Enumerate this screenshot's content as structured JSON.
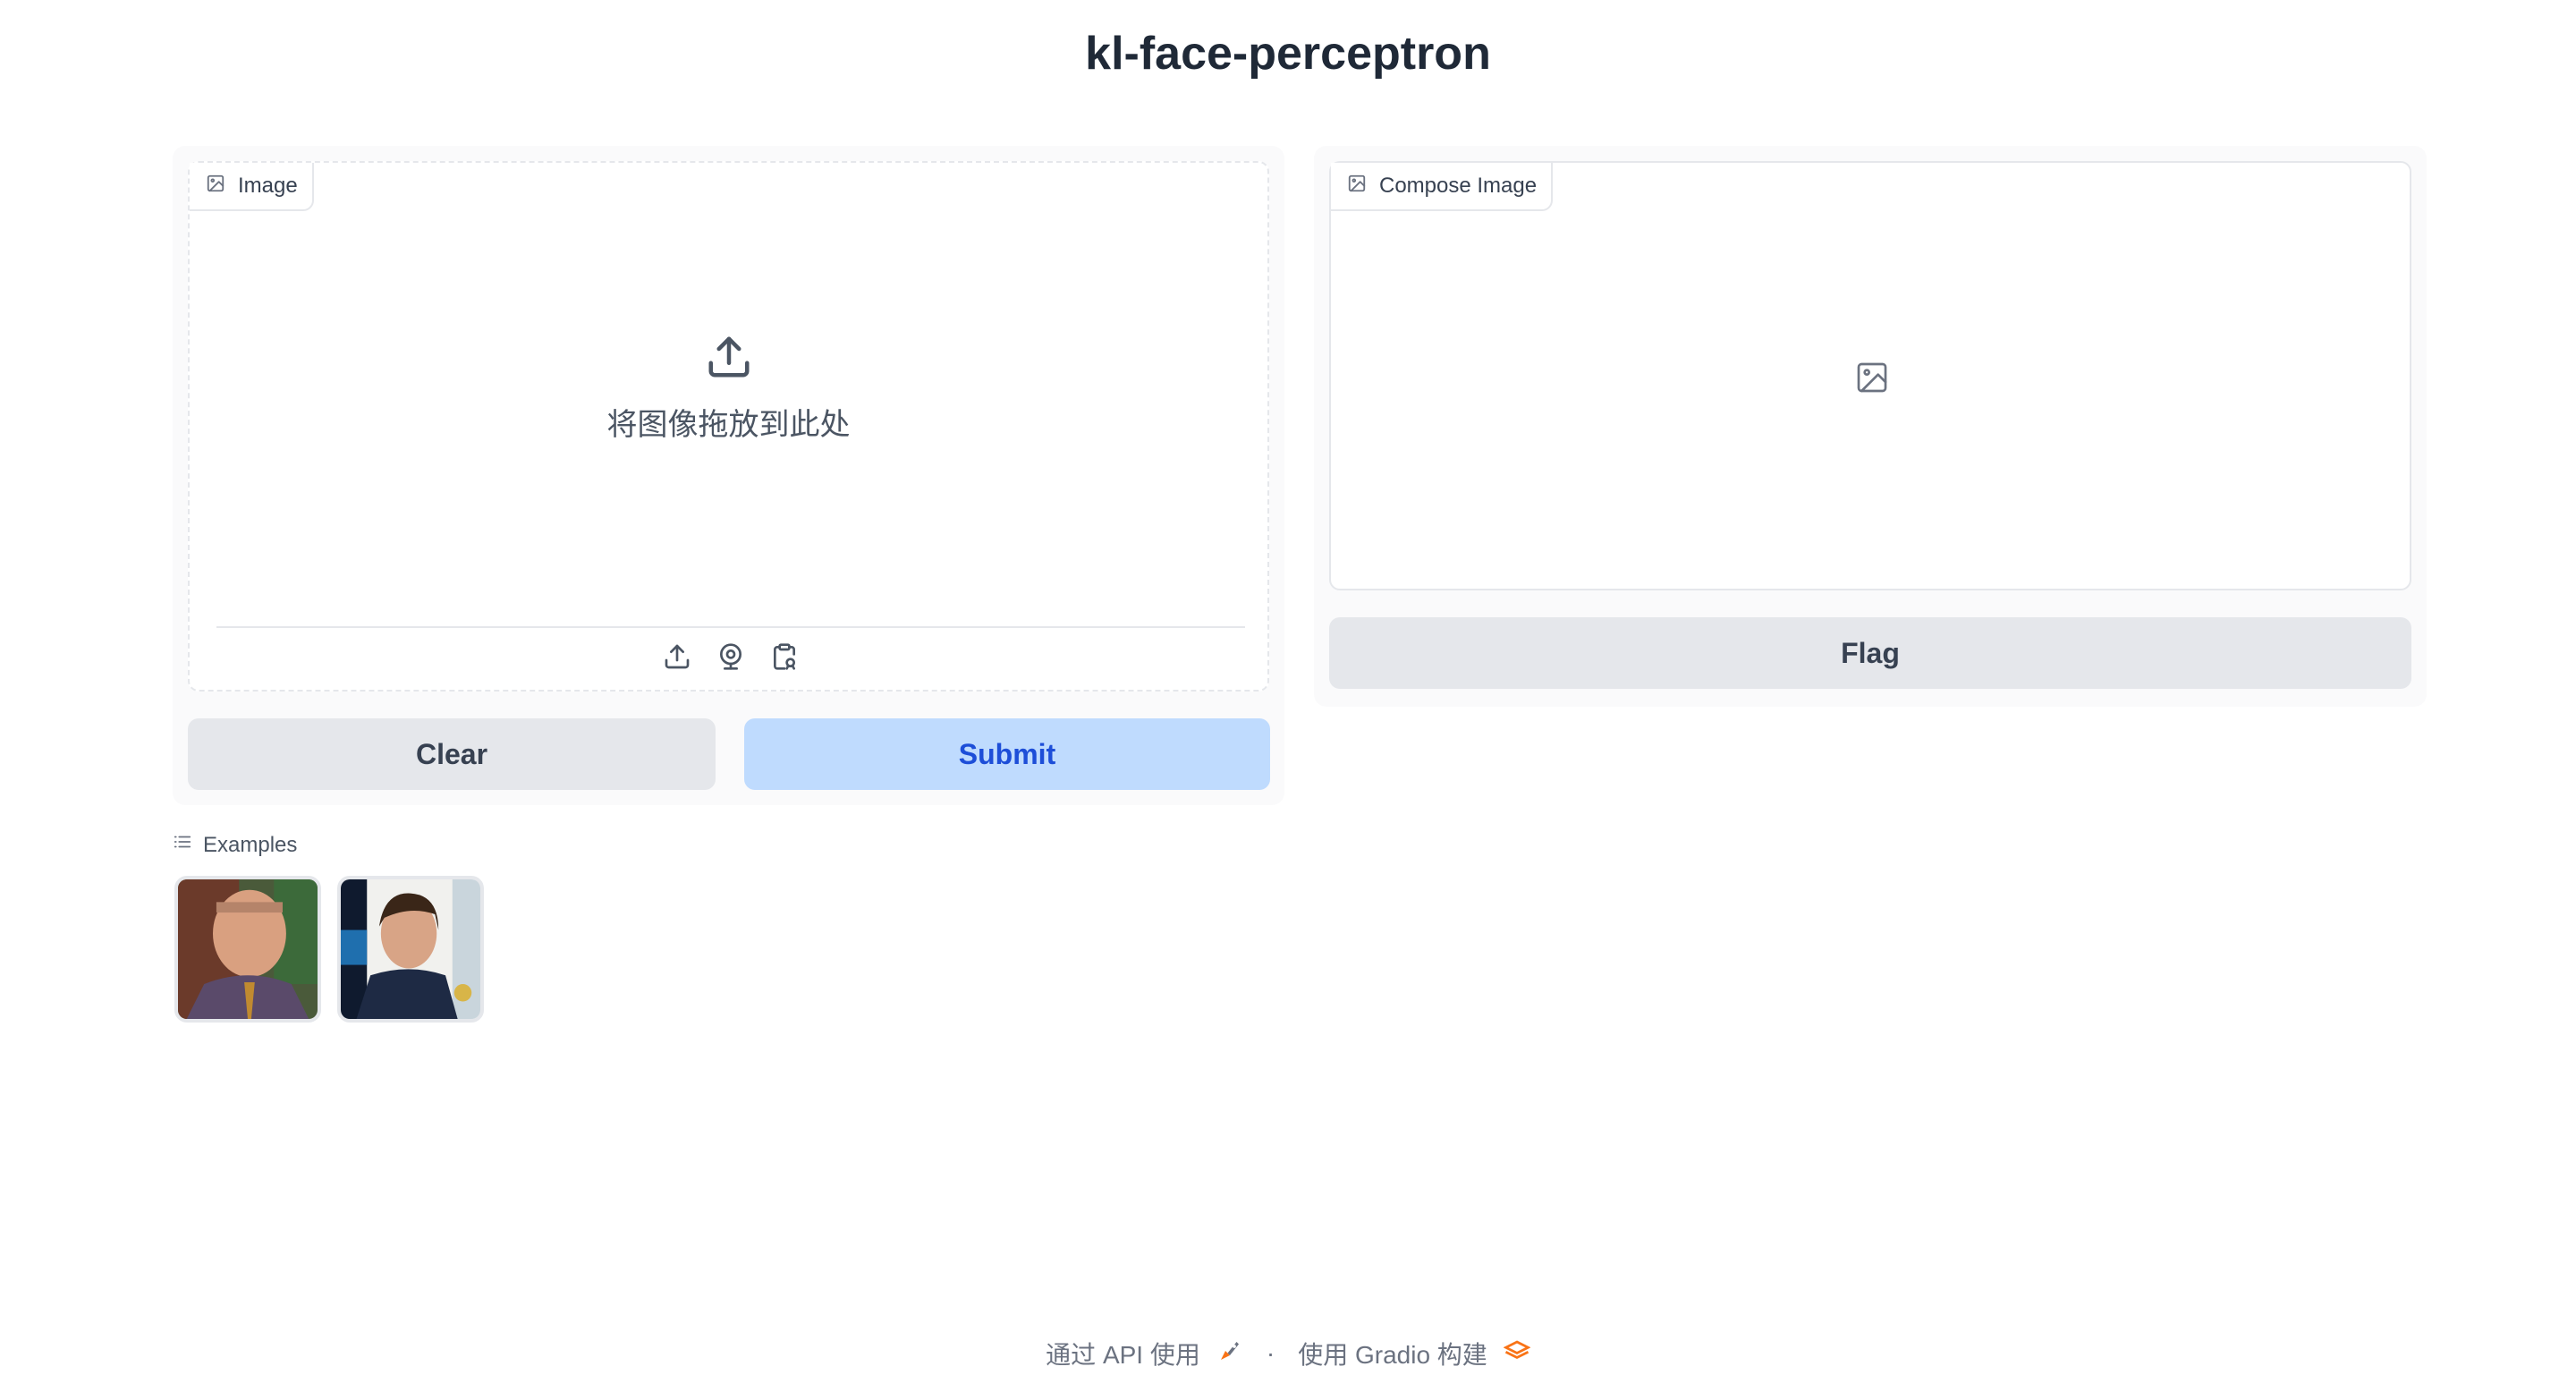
{
  "app": {
    "title": "kl-face-perceptron"
  },
  "input": {
    "label": "Image",
    "drop_text": "将图像拖放到此处",
    "label_icon": "image-icon",
    "toolbar_icons": [
      "upload-icon",
      "webcam-icon",
      "clipboard-icon"
    ]
  },
  "output": {
    "label": "Compose Image",
    "label_icon": "image-icon"
  },
  "buttons": {
    "clear": "Clear",
    "submit": "Submit",
    "flag": "Flag"
  },
  "examples": {
    "label": "Examples",
    "count": 2
  },
  "footer": {
    "api_text": "通过 API 使用",
    "separator": "·",
    "built_text": "使用 Gradio 构建"
  },
  "colors": {
    "submit_bg": "#bfdbfe",
    "submit_text": "#1d4ed8",
    "secondary_bg": "#e5e7eb"
  }
}
